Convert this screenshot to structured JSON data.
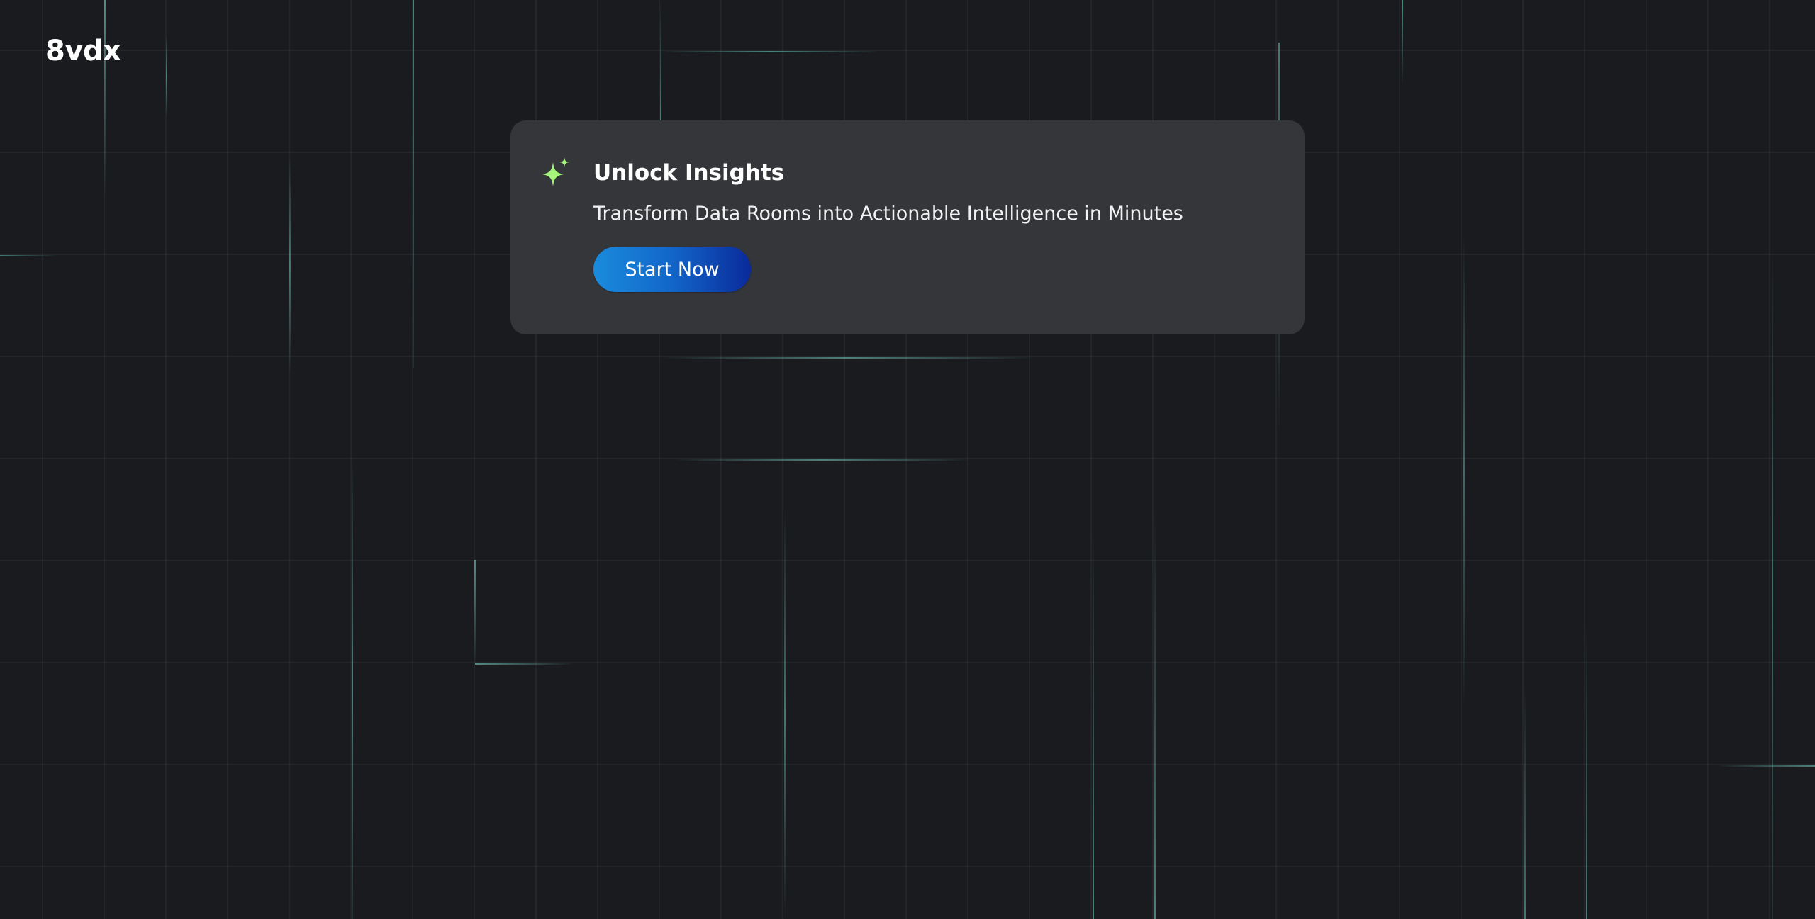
{
  "brand": {
    "logo_text": "8vdx"
  },
  "promo_card": {
    "icon": "sparkle-icon",
    "title": "Unlock Insights",
    "subtitle": "Transform Data Rooms into Actionable Intelligence in Minutes",
    "cta_label": "Start Now"
  },
  "colors": {
    "background": "#191b1e",
    "card": "#35363a",
    "accent_sparkle": "#a5f47c",
    "cta_gradient_start": "#1a8bdc",
    "cta_gradient_end": "#0a2a9a",
    "glow_line": "#7fe6d6"
  }
}
